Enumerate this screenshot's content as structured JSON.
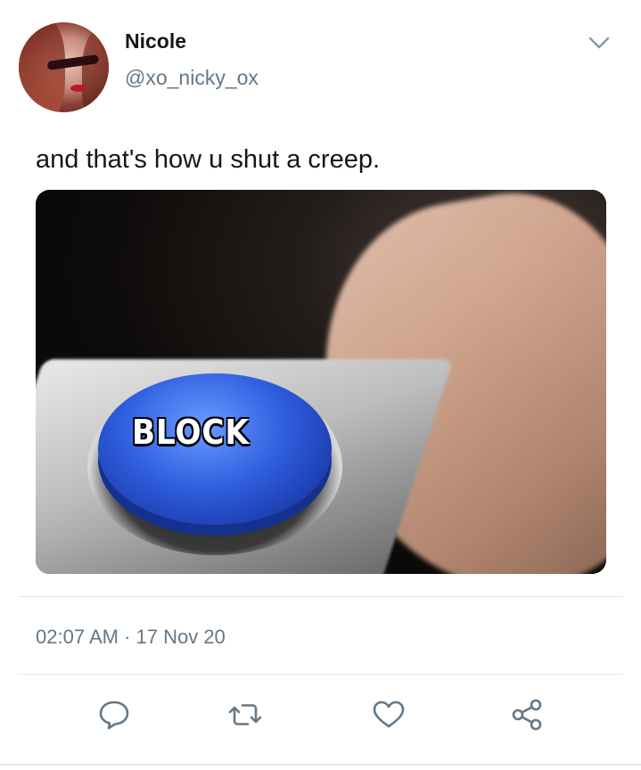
{
  "user": {
    "name": "Nicole",
    "handle": "@xo_nicky_ox"
  },
  "tweet": {
    "text": "and that's how u shut a creep.",
    "media_label": "BLOCK",
    "timestamp": "02:07 AM · 17 Nov 20"
  },
  "icons": {
    "menu": "chevron-down-icon",
    "reply": "reply-icon",
    "retweet": "retweet-icon",
    "like": "heart-icon",
    "share": "share-icon"
  },
  "colors": {
    "text": "#14171a",
    "secondary": "#657786",
    "divider": "#e1e8ed",
    "icon": "#657786",
    "button_blue": "#2f5ee0"
  }
}
